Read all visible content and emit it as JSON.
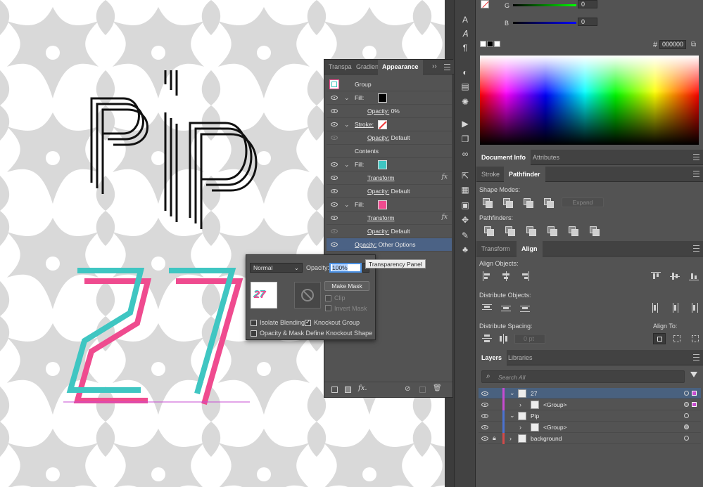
{
  "appearance_panel": {
    "tabs": [
      "Transpa",
      "Gradien",
      "Appearance"
    ],
    "rows": [
      {
        "kind": "header",
        "label": "Group"
      },
      {
        "kind": "fill",
        "label": "Fill:",
        "swatch": "#000000"
      },
      {
        "kind": "sub",
        "label": "Opacity:",
        "value": "0%"
      },
      {
        "kind": "stroke",
        "label": "Stroke:",
        "swatch": "none"
      },
      {
        "kind": "sub",
        "label": "Opacity:",
        "value": "Default"
      },
      {
        "kind": "plain",
        "label": "Contents"
      },
      {
        "kind": "fill",
        "label": "Fill:",
        "swatch": "#3fc6c2"
      },
      {
        "kind": "effect",
        "label": "Transform"
      },
      {
        "kind": "sub",
        "label": "Opacity:",
        "value": "Default"
      },
      {
        "kind": "fill",
        "label": "Fill:",
        "swatch": "#ef4b8f"
      },
      {
        "kind": "effect",
        "label": "Transform"
      },
      {
        "kind": "sub",
        "label": "Opacity:",
        "value": "Default"
      },
      {
        "kind": "selected",
        "label": "Opacity:",
        "value": "Other Options"
      }
    ],
    "fx_label": "fx",
    "bottom_fx": "fx."
  },
  "transparency_popup": {
    "blend_mode": "Normal",
    "opacity_label": "Opacity:",
    "opacity_value": "100%",
    "make_mask": "Make Mask",
    "clip": "Clip",
    "invert_mask": "Invert Mask",
    "isolate_blending": "Isolate Blending",
    "knockout_group": "Knockout Group",
    "opacity_mask": "Opacity & Mask Define Knockout Shape",
    "thumbnail_text": "27"
  },
  "tooltip": "Transparency Panel",
  "artwork": {
    "word1": "Pip",
    "word2": "27",
    "teal": "#3fc6c2",
    "pink": "#ef4b8f"
  },
  "color_panel": {
    "g_label": "G",
    "g_value": "0",
    "b_label": "B",
    "b_value": "0",
    "hex_prefix": "#",
    "hex": "000000"
  },
  "doc_tabs": {
    "a": "Document Info",
    "b": "Attributes"
  },
  "pathfinder_tabs": {
    "a": "Stroke",
    "b": "Pathfinder"
  },
  "pathfinder": {
    "shape_modes": "Shape Modes:",
    "expand": "Expand",
    "pathfinders": "Pathfinders:"
  },
  "align_tabs": {
    "a": "Transform",
    "b": "Align"
  },
  "align": {
    "align_objects": "Align Objects:",
    "distribute_objects": "Distribute Objects:",
    "distribute_spacing": "Distribute Spacing:",
    "align_to": "Align To:",
    "spacing_value": "0 pt"
  },
  "layers_tabs": {
    "a": "Layers",
    "b": "Libraries"
  },
  "layers": {
    "search_placeholder": "Search All",
    "rows": [
      {
        "name": "27",
        "color": "#c74bd1"
      },
      {
        "name": "<Group>",
        "color": "#c74bd1"
      },
      {
        "name": "Pip",
        "color": "#4b72d1"
      },
      {
        "name": "<Group>",
        "color": "#4b72d1"
      },
      {
        "name": "background",
        "color": "#d14b4b"
      }
    ]
  }
}
